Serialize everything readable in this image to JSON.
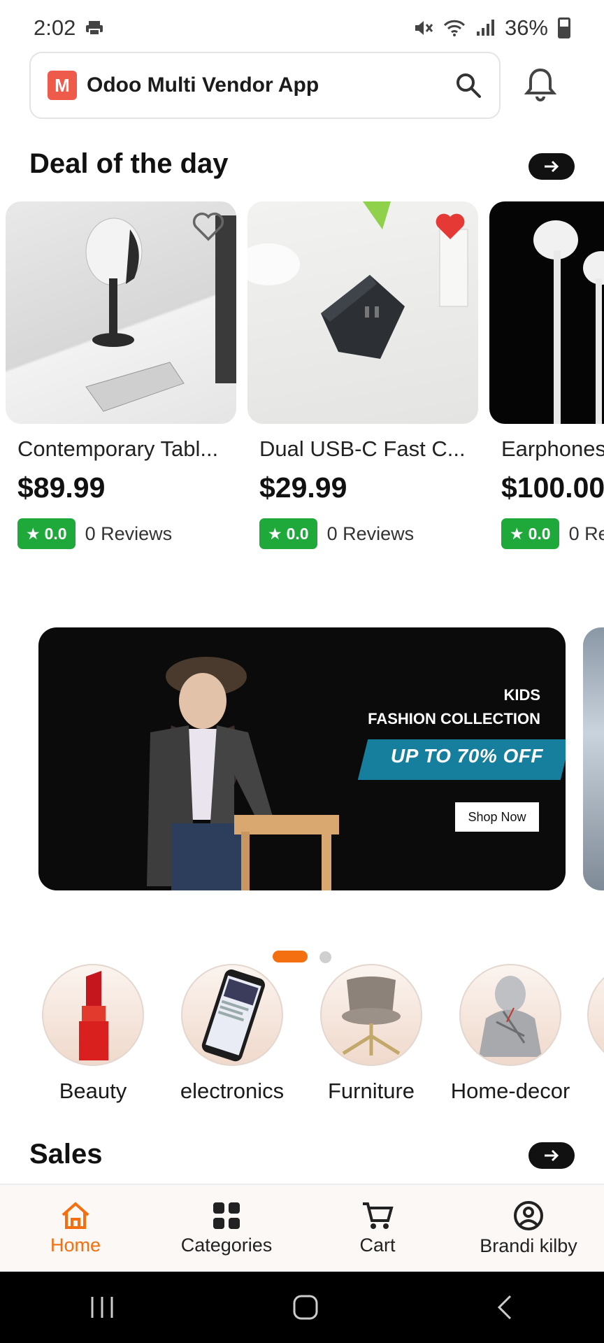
{
  "status": {
    "time": "2:02",
    "battery": "36%"
  },
  "header": {
    "app_title": "Odoo Multi Vendor App",
    "logo_letter": "M"
  },
  "deal_section": {
    "title": "Deal of the day"
  },
  "products": [
    {
      "name": "Contemporary Tabl...",
      "price": "$89.99",
      "rating": "0.0",
      "reviews": "0 Reviews",
      "favorited": false
    },
    {
      "name": "Dual USB-C Fast C...",
      "price": "$29.99",
      "rating": "0.0",
      "reviews": "0 Reviews",
      "favorited": true
    },
    {
      "name": "Earphones",
      "price": "$100.00",
      "rating": "0.0",
      "reviews": "0 Reviews",
      "favorited": false
    }
  ],
  "banner": {
    "line1": "KIDS",
    "line2": "FASHION COLLECTION",
    "offer": "UP TO 70% OFF",
    "cta": "Shop Now"
  },
  "categories": [
    {
      "label": "Beauty"
    },
    {
      "label": "electronics"
    },
    {
      "label": "Furniture"
    },
    {
      "label": "Home-decor"
    }
  ],
  "sales_section": {
    "title": "Sales"
  },
  "bottom_nav": {
    "home": "Home",
    "categories": "Categories",
    "cart": "Cart",
    "profile": "Brandi kilby"
  },
  "colors": {
    "accent": "#f36f10",
    "rating_green": "#1fa93b",
    "heart_red": "#e53935"
  }
}
